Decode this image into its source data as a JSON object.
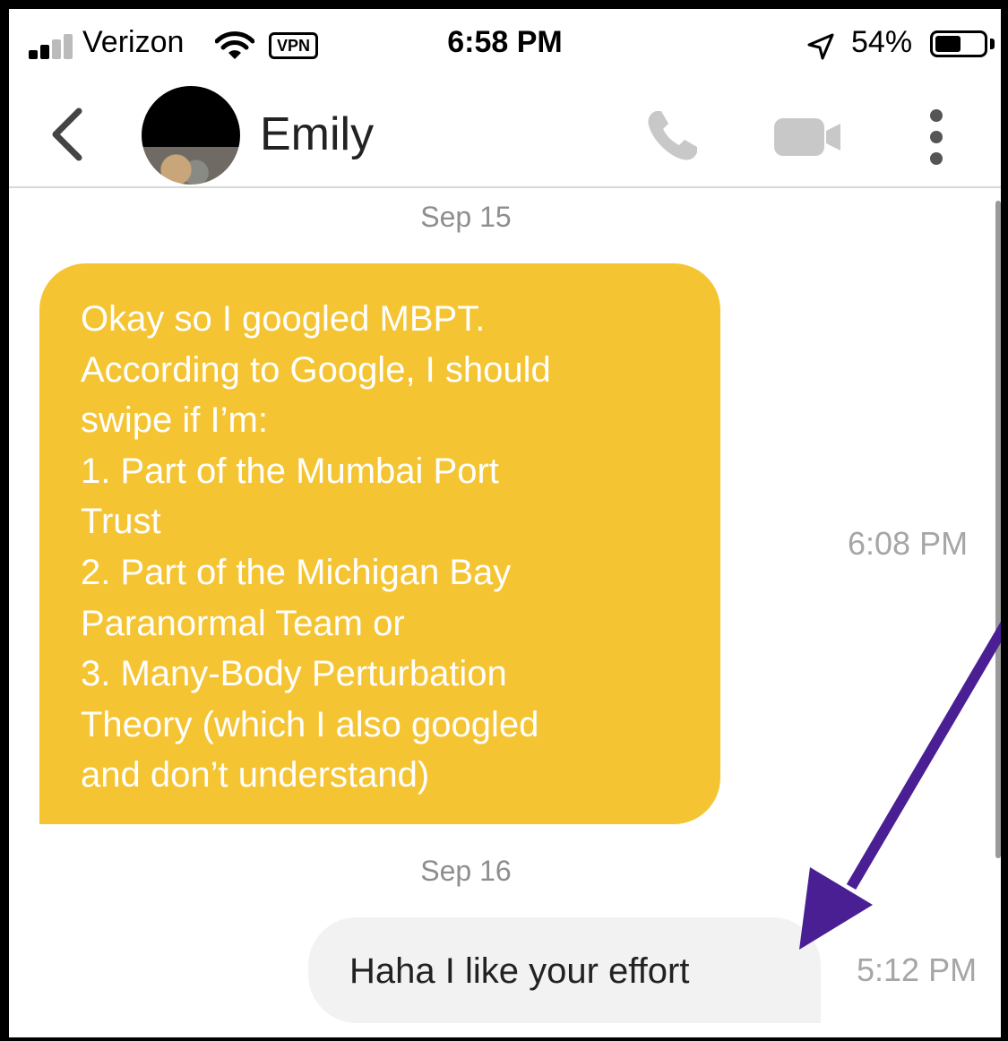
{
  "status_bar": {
    "carrier": "Verizon",
    "vpn": "VPN",
    "time": "6:58 PM",
    "battery_percent_text": "54%",
    "battery_level": 0.54
  },
  "header": {
    "contact_name": "Emily",
    "back_icon": "chevron-left-icon",
    "call_icon": "phone-icon",
    "video_icon": "video-camera-icon",
    "more_icon": "more-vertical-icon"
  },
  "conversation": {
    "groups": [
      {
        "date": "Sep 15",
        "message": {
          "direction": "incoming",
          "text": "Okay so I googled MBPT.\nAccording to Google, I should\nswipe if I’m:\n1. Part of the Mumbai Port\nTrust\n2. Part of the Michigan Bay\nParanormal Team or\n3. Many-Body Perturbation\nTheory (which I also googled\nand don’t understand)",
          "time": "6:08 PM"
        }
      },
      {
        "date": "Sep 16",
        "message": {
          "direction": "outgoing",
          "text": "Haha I like your effort",
          "time": "5:12 PM"
        }
      }
    ]
  },
  "colors": {
    "incoming_bubble": "#f5c433",
    "outgoing_bubble": "#f2f2f2",
    "annotation_arrow": "#4a1f94"
  }
}
